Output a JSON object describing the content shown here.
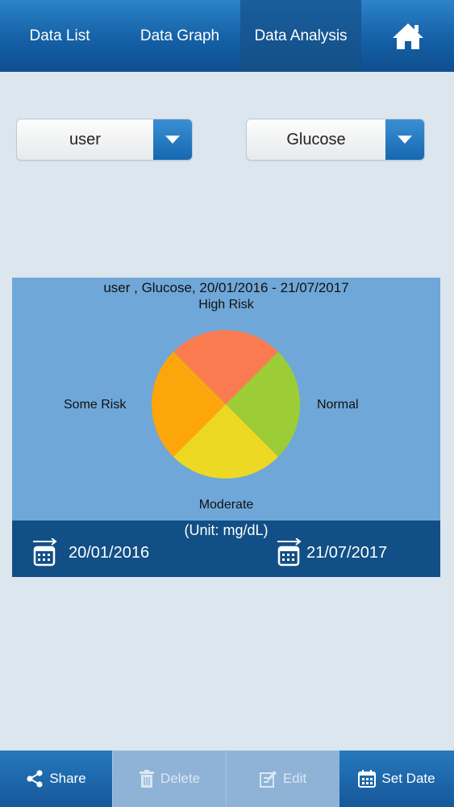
{
  "nav": {
    "tabs": [
      {
        "label": "Data List"
      },
      {
        "label": "Data Graph"
      },
      {
        "label": "Data Analysis",
        "active": true
      }
    ],
    "home_icon": "home-icon"
  },
  "filters": {
    "user": "user",
    "measure": "Glucose",
    "dropdown_icon": "chevron-down-icon"
  },
  "chart_data": {
    "type": "pie",
    "title": "user , Glucose, 20/01/2016 - 21/07/2017",
    "slices": [
      {
        "label": "High Risk",
        "value": 25,
        "color": "#fb7b50"
      },
      {
        "label": "Normal",
        "value": 25,
        "color": "#9ccd37"
      },
      {
        "label": "Moderate",
        "value": 25,
        "color": "#edd823"
      },
      {
        "label": "Some Risk",
        "value": 25,
        "color": "#fca60b"
      }
    ],
    "unit": "(Unit: mg/dL)"
  },
  "date_range": {
    "start": "20/01/2016",
    "end": "21/07/2017",
    "icon": "calendar-icon"
  },
  "toolbar": {
    "share": "Share",
    "delete": "Delete",
    "edit": "Edit",
    "set_date": "Set Date"
  },
  "colors": {
    "primary": "#1668b0",
    "panel": "#6fa7d8",
    "panel_footer": "#124f86",
    "background": "#dce6ef"
  }
}
